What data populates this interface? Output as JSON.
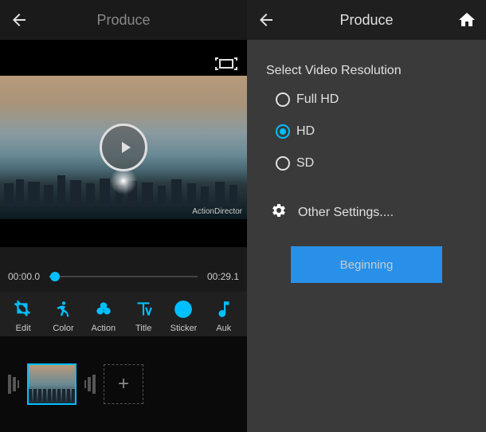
{
  "left": {
    "header": {
      "title": "Produce"
    },
    "preview": {
      "watermark": "ActionDirector"
    },
    "scrubber": {
      "time_start": "00:00.0",
      "time_end": "00:29.1"
    },
    "toolbar": {
      "items": [
        {
          "name": "edit",
          "label": "Edit"
        },
        {
          "name": "color",
          "label": "Color"
        },
        {
          "name": "action",
          "label": "Action"
        },
        {
          "name": "title",
          "label": "Title"
        },
        {
          "name": "sticker",
          "label": "Sticker"
        },
        {
          "name": "audio",
          "label": "Auk"
        }
      ]
    },
    "add_clip": "+"
  },
  "right": {
    "header": {
      "title": "Produce"
    },
    "section_title": "Select Video Resolution",
    "options": [
      {
        "id": "fullhd",
        "label": "Full HD",
        "selected": false
      },
      {
        "id": "hd",
        "label": "HD",
        "selected": true
      },
      {
        "id": "sd",
        "label": "SD",
        "selected": false
      }
    ],
    "other_settings": "Other Settings....",
    "primary_button": "Beginning"
  },
  "colors": {
    "accent": "#00bfff",
    "primary_button": "#2890e8"
  }
}
